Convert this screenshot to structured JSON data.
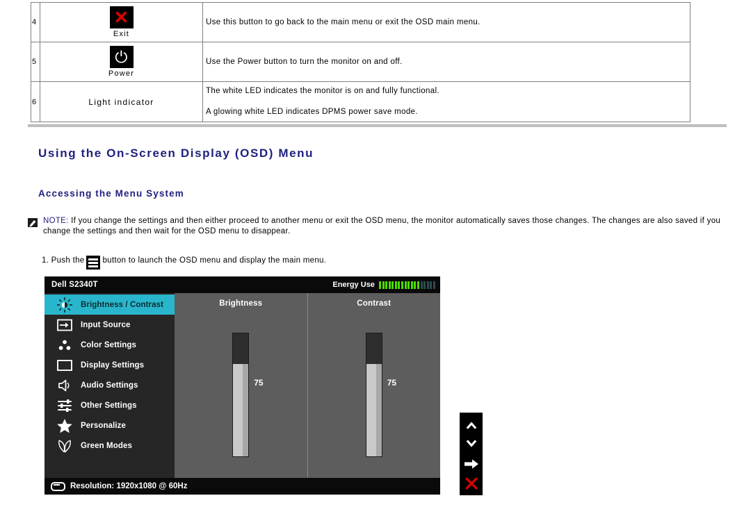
{
  "table": {
    "rows": [
      {
        "num": "4",
        "icon": "exit-x-icon",
        "icon_label": "Exit",
        "desc": [
          "Use this button to go back to the main menu or exit the OSD main menu."
        ]
      },
      {
        "num": "5",
        "icon": "power-icon",
        "icon_label": "Power",
        "desc": [
          "Use the Power button to turn the monitor on and off."
        ]
      },
      {
        "num": "6",
        "icon": "",
        "icon_label": "Light indicator",
        "desc": [
          "The white LED indicates the monitor is on and fully functional.",
          "A glowing white LED indicates DPMS power save mode."
        ]
      }
    ]
  },
  "headings": {
    "h1": "Using the On-Screen Display (OSD) Menu",
    "h2": "Accessing the Menu System"
  },
  "note": {
    "keyword": "NOTE:",
    "body": " If you change the settings and then either proceed to another menu or exit the OSD menu, the monitor automatically saves those changes. The changes are also saved if you change the settings and then wait for the OSD menu to disappear."
  },
  "step": {
    "prefix": "1. Push the",
    "suffix": "button to launch the OSD menu and display the main menu."
  },
  "osd": {
    "model": "Dell S2340T",
    "energy_label": "Energy Use",
    "energy_bars_lit": 13,
    "energy_bars_dim": 5,
    "menu": [
      {
        "label": "Brightness / Contrast",
        "icon": "brightness-icon",
        "active": true
      },
      {
        "label": "Input Source",
        "icon": "input-source-icon",
        "active": false
      },
      {
        "label": "Color Settings",
        "icon": "color-settings-icon",
        "active": false
      },
      {
        "label": "Display Settings",
        "icon": "display-settings-icon",
        "active": false
      },
      {
        "label": "Audio Settings",
        "icon": "audio-settings-icon",
        "active": false
      },
      {
        "label": "Other Settings",
        "icon": "other-settings-icon",
        "active": false
      },
      {
        "label": "Personalize",
        "icon": "star-icon",
        "active": false
      },
      {
        "label": "Green Modes",
        "icon": "green-modes-leaf-icon",
        "active": false
      }
    ],
    "panes": [
      {
        "title": "Brightness",
        "value": "75",
        "percent": 75
      },
      {
        "title": "Contrast",
        "value": "75",
        "percent": 75
      }
    ],
    "footer": "Resolution: 1920x1080 @ 60Hz",
    "nav_buttons": [
      {
        "name": "up-chevron-icon"
      },
      {
        "name": "down-chevron-icon"
      },
      {
        "name": "right-arrow-icon"
      },
      {
        "name": "close-x-icon"
      }
    ],
    "colors": {
      "highlight": "#29b6cc",
      "energy_lit": "#4cdb00",
      "energy_dim": "#2c4a4f",
      "pane_bg": "#5d5d5d",
      "menu_bg": "#262626",
      "bar_bg": "#0a0a0a"
    }
  },
  "doc_colors": {
    "heading": "#21217f",
    "exit_red": "#e00000"
  }
}
